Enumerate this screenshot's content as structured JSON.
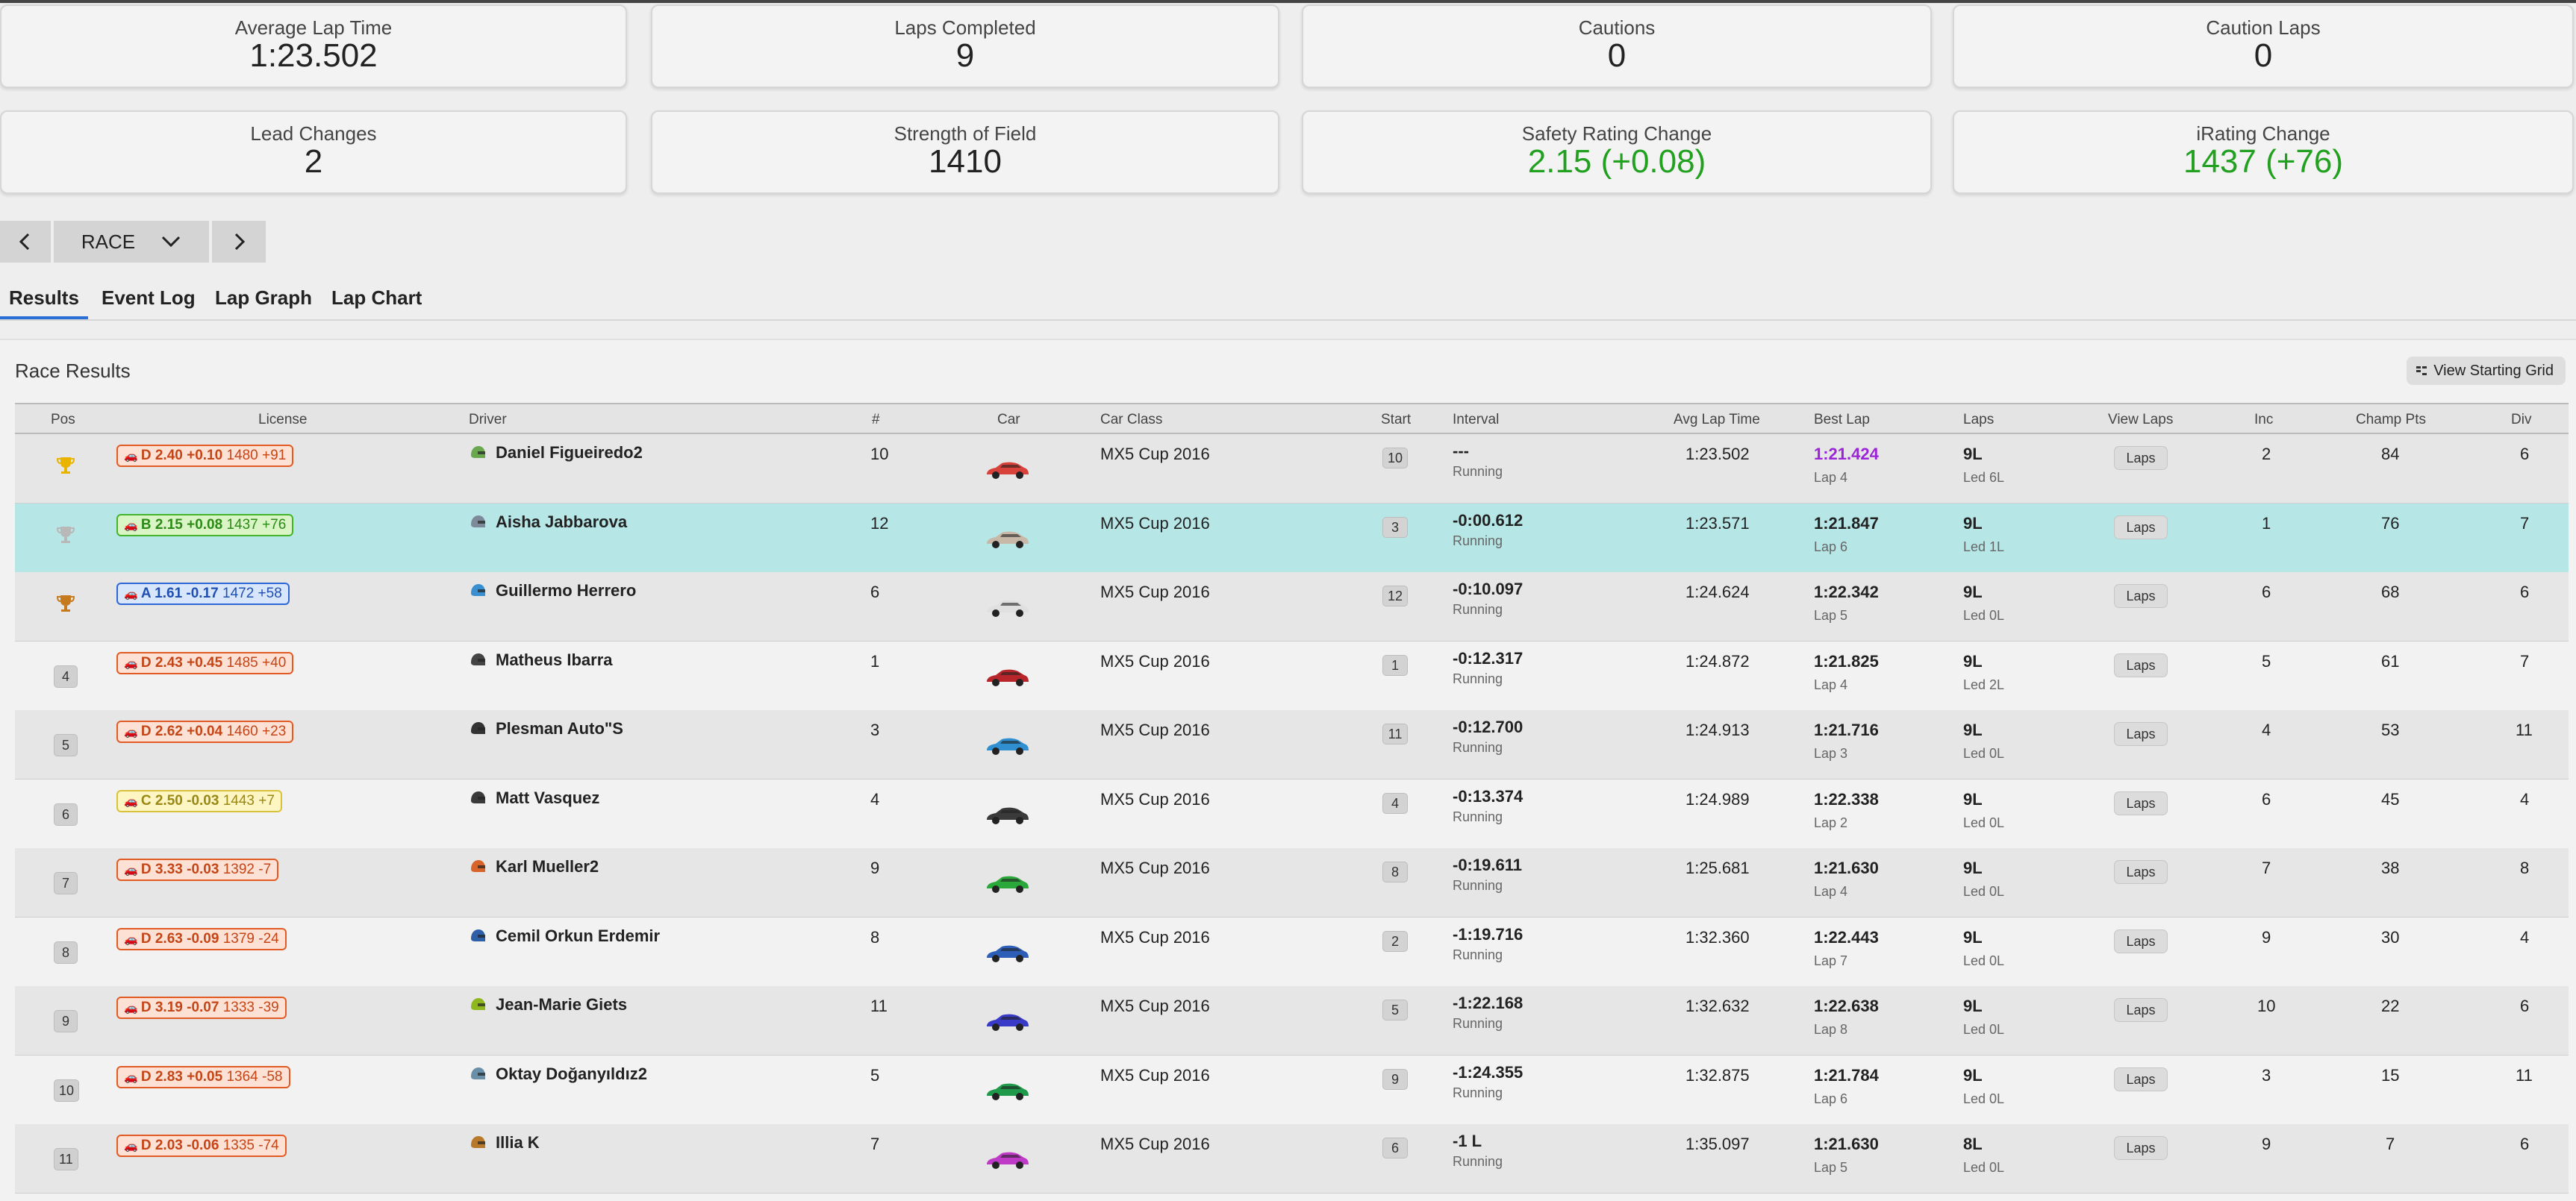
{
  "stats": [
    {
      "label": "Average Lap Time",
      "value": "1:23.502"
    },
    {
      "label": "Laps Completed",
      "value": "9"
    },
    {
      "label": "Cautions",
      "value": "0"
    },
    {
      "label": "Caution Laps",
      "value": "0"
    },
    {
      "label": "Lead Changes",
      "value": "2"
    },
    {
      "label": "Strength of Field",
      "value": "1410"
    },
    {
      "label": "Safety Rating Change",
      "value": "2.15 (+0.08)"
    },
    {
      "label": "iRating Change",
      "value": "1437 (+76)"
    }
  ],
  "session_selector": {
    "value": "RACE"
  },
  "tabs": [
    "Results",
    "Event Log",
    "Lap Graph",
    "Lap Chart"
  ],
  "panel": {
    "title": "Race Results",
    "starting_grid_label": "View Starting Grid"
  },
  "columns": {
    "pos": "Pos",
    "license": "License",
    "driver": "Driver",
    "num": "#",
    "car": "Car",
    "car_class": "Car Class",
    "start": "Start",
    "interval": "Interval",
    "avg": "Avg Lap Time",
    "best": "Best Lap",
    "laps": "Laps",
    "view_laps": "View Laps",
    "inc": "Inc",
    "champ": "Champ Pts",
    "div": "Div"
  },
  "laps_button_label": "Laps",
  "colors": {
    "accent_green": "#22a020",
    "highlight_row": "#b7e6e6",
    "fastest_lap": "#9b24d8",
    "tab_underline": "#2a6fd6"
  },
  "rows": [
    {
      "pos": "1",
      "trophy": "gold",
      "lic_class": "D",
      "lic_sr": "D 2.40 +0.10",
      "lic_ir": "1480 +91",
      "driver": "Daniel Figueiredo2",
      "helmet": "#6aa84f",
      "num": "10",
      "car_color": "#d9423a",
      "car_class": "MX5 Cup 2016",
      "start": "10",
      "interval": "---",
      "status": "Running",
      "avg": "1:23.502",
      "best": "1:21.424",
      "best_lap": "Lap 4",
      "laps": "9L",
      "led": "Led 6L",
      "inc": "2",
      "champ": "84",
      "div": "6"
    },
    {
      "pos": "2",
      "trophy": "silver",
      "lic_class": "B",
      "lic_sr": "B 2.15 +0.08",
      "lic_ir": "1437 +76",
      "driver": "Aisha Jabbarova",
      "helmet": "#7d8a99",
      "num": "12",
      "car_color": "#c8b8a8",
      "car_class": "MX5 Cup 2016",
      "start": "3",
      "interval": "-0:00.612",
      "status": "Running",
      "avg": "1:23.571",
      "best": "1:21.847",
      "best_lap": "Lap 6",
      "laps": "9L",
      "led": "Led 1L",
      "inc": "1",
      "champ": "76",
      "div": "7"
    },
    {
      "pos": "3",
      "trophy": "bronze",
      "lic_class": "A",
      "lic_sr": "A 1.61 -0.17",
      "lic_ir": "1472 +58",
      "driver": "Guillermo Herrero",
      "helmet": "#3a8fd1",
      "num": "6",
      "car_color": "#e0e0e0",
      "car_class": "MX5 Cup 2016",
      "start": "12",
      "interval": "-0:10.097",
      "status": "Running",
      "avg": "1:24.624",
      "best": "1:22.342",
      "best_lap": "Lap 5",
      "laps": "9L",
      "led": "Led 0L",
      "inc": "6",
      "champ": "68",
      "div": "6"
    },
    {
      "pos": "4",
      "trophy": "",
      "lic_class": "D",
      "lic_sr": "D 2.43 +0.45",
      "lic_ir": "1485 +40",
      "driver": "Matheus Ibarra",
      "helmet": "#444444",
      "num": "1",
      "car_color": "#b8262c",
      "car_class": "MX5 Cup 2016",
      "start": "1",
      "interval": "-0:12.317",
      "status": "Running",
      "avg": "1:24.872",
      "best": "1:21.825",
      "best_lap": "Lap 4",
      "laps": "9L",
      "led": "Led 2L",
      "inc": "5",
      "champ": "61",
      "div": "7"
    },
    {
      "pos": "5",
      "trophy": "",
      "lic_class": "D",
      "lic_sr": "D 2.62 +0.04",
      "lic_ir": "1460 +23",
      "driver": "Plesman Auto\"S",
      "helmet": "#333333",
      "num": "3",
      "car_color": "#2f8fd0",
      "car_class": "MX5 Cup 2016",
      "start": "11",
      "interval": "-0:12.700",
      "status": "Running",
      "avg": "1:24.913",
      "best": "1:21.716",
      "best_lap": "Lap 3",
      "laps": "9L",
      "led": "Led 0L",
      "inc": "4",
      "champ": "53",
      "div": "11"
    },
    {
      "pos": "6",
      "trophy": "",
      "lic_class": "C",
      "lic_sr": "C 2.50 -0.03",
      "lic_ir": "1443 +7",
      "driver": "Matt Vasquez",
      "helmet": "#3a3a3a",
      "num": "4",
      "car_color": "#3a3a3a",
      "car_class": "MX5 Cup 2016",
      "start": "4",
      "interval": "-0:13.374",
      "status": "Running",
      "avg": "1:24.989",
      "best": "1:22.338",
      "best_lap": "Lap 2",
      "laps": "9L",
      "led": "Led 0L",
      "inc": "6",
      "champ": "45",
      "div": "4"
    },
    {
      "pos": "7",
      "trophy": "",
      "lic_class": "D",
      "lic_sr": "D 3.33 -0.03",
      "lic_ir": "1392 -7",
      "driver": "Karl Mueller2",
      "helmet": "#d9642a",
      "num": "9",
      "car_color": "#2aa83a",
      "car_class": "MX5 Cup 2016",
      "start": "8",
      "interval": "-0:19.611",
      "status": "Running",
      "avg": "1:25.681",
      "best": "1:21.630",
      "best_lap": "Lap 4",
      "laps": "9L",
      "led": "Led 0L",
      "inc": "7",
      "champ": "38",
      "div": "8"
    },
    {
      "pos": "8",
      "trophy": "",
      "lic_class": "D",
      "lic_sr": "D 2.63 -0.09",
      "lic_ir": "1379 -24",
      "driver": "Cemil Orkun Erdemir",
      "helmet": "#2d5fa8",
      "num": "8",
      "car_color": "#2d5fb8",
      "car_class": "MX5 Cup 2016",
      "start": "2",
      "interval": "-1:19.716",
      "status": "Running",
      "avg": "1:32.360",
      "best": "1:22.443",
      "best_lap": "Lap 7",
      "laps": "9L",
      "led": "Led 0L",
      "inc": "9",
      "champ": "30",
      "div": "4"
    },
    {
      "pos": "9",
      "trophy": "",
      "lic_class": "D",
      "lic_sr": "D 3.19 -0.07",
      "lic_ir": "1333 -39",
      "driver": "Jean-Marie Giets",
      "helmet": "#8fb81e",
      "num": "11",
      "car_color": "#3a3ac8",
      "car_class": "MX5 Cup 2016",
      "start": "5",
      "interval": "-1:22.168",
      "status": "Running",
      "avg": "1:32.632",
      "best": "1:22.638",
      "best_lap": "Lap 8",
      "laps": "9L",
      "led": "Led 0L",
      "inc": "10",
      "champ": "22",
      "div": "6"
    },
    {
      "pos": "10",
      "trophy": "",
      "lic_class": "D",
      "lic_sr": "D 2.83 +0.05",
      "lic_ir": "1364 -58",
      "driver": "Oktay Doğanyıldız2",
      "helmet": "#6a8fa8",
      "num": "5",
      "car_color": "#1e9a4a",
      "car_class": "MX5 Cup 2016",
      "start": "9",
      "interval": "-1:24.355",
      "status": "Running",
      "avg": "1:32.875",
      "best": "1:21.784",
      "best_lap": "Lap 6",
      "laps": "9L",
      "led": "Led 0L",
      "inc": "3",
      "champ": "15",
      "div": "11"
    },
    {
      "pos": "11",
      "trophy": "",
      "lic_class": "D",
      "lic_sr": "D 2.03 -0.06",
      "lic_ir": "1335 -74",
      "driver": "Illia K",
      "helmet": "#b87a2a",
      "num": "7",
      "car_color": "#c03ac8",
      "car_class": "MX5 Cup 2016",
      "start": "6",
      "interval": "-1 L",
      "status": "Running",
      "avg": "1:35.097",
      "best": "1:21.630",
      "best_lap": "Lap 5",
      "laps": "8L",
      "led": "Led 0L",
      "inc": "9",
      "champ": "7",
      "div": "6"
    }
  ]
}
